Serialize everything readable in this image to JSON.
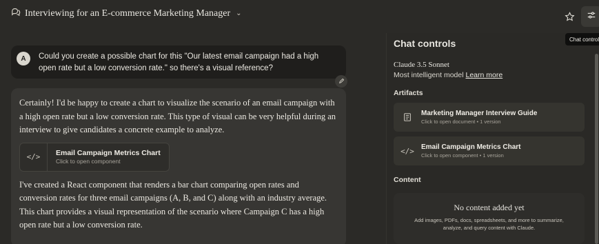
{
  "header": {
    "chat_title": "Interviewing for an E-commerce Marketing Manager",
    "chat_icon": "chat-bubbles-icon",
    "star_icon": "star-icon",
    "controls_icon": "sliders-icon",
    "tooltip": "Chat controls"
  },
  "user_message": {
    "avatar_initial": "A",
    "text": "Could you create a possible chart for this \"Our latest email campaign had a high open rate but a low conversion rate.\" so there's a visual reference?"
  },
  "assistant_message": {
    "para1": "Certainly! I'd be happy to create a chart to visualize the scenario of an email campaign with a high open rate but a low conversion rate. This type of visual can be very helpful during an interview to give candidates a concrete example to analyze.",
    "artifact": {
      "title": "Email Campaign Metrics Chart",
      "subtitle": "Click to open component",
      "icon_text": "</>"
    },
    "para2": "I've created a React component that renders a bar chart comparing open rates and conversion rates for three email campaigns (A, B, and C) along with an industry average. This chart provides a visual representation of the scenario where Campaign C has a high open rate but a low conversion rate."
  },
  "panel": {
    "title": "Chat controls",
    "model_name": "Claude 3.5 Sonnet",
    "model_desc": "Most intelligent model",
    "learn_more": "Learn more",
    "artifacts_label": "Artifacts",
    "artifacts": [
      {
        "title": "Marketing Manager Interview Guide",
        "subtitle": "Click to open document • 1 version",
        "icon": "document-icon"
      },
      {
        "title": "Email Campaign Metrics Chart",
        "subtitle": "Click to open component • 1 version",
        "icon_text": "</>"
      }
    ],
    "content_label": "Content",
    "empty_title": "No content added yet",
    "empty_desc": "Add images, PDFs, docs, spreadsheets, and more to summarize, analyze, and query content with Claude."
  },
  "colors": {
    "background": "#2b2a27",
    "user_bubble": "#1f1e1c",
    "assistant_bubble": "#373633",
    "panel": "#2a2926"
  }
}
